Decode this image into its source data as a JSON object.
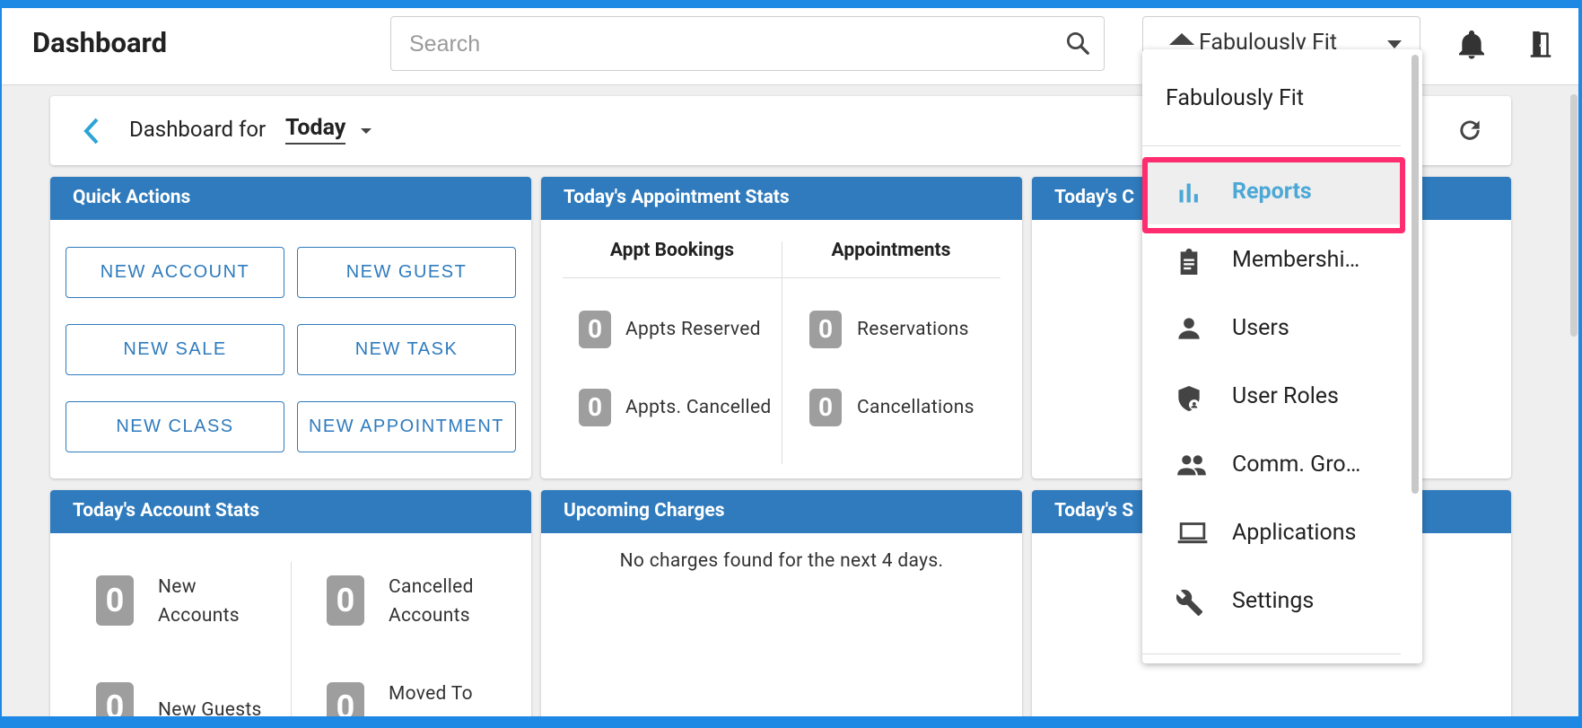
{
  "header": {
    "title": "Dashboard",
    "search_placeholder": "Search",
    "club_name": "Fabulously Fit"
  },
  "dashboard_bar": {
    "label": "Dashboard for",
    "period": "Today"
  },
  "quick_actions": {
    "title": "Quick Actions",
    "buttons": [
      "NEW ACCOUNT",
      "NEW GUEST",
      "NEW SALE",
      "NEW TASK",
      "NEW CLASS",
      "NEW APPOINTMENT"
    ]
  },
  "appointment_stats": {
    "title": "Today's Appointment Stats",
    "col1_header": "Appt Bookings",
    "col2_header": "Appointments",
    "rows": [
      {
        "left_value": "0",
        "left_label": "Appts Reserved",
        "right_value": "0",
        "right_label": "Reservations"
      },
      {
        "left_value": "0",
        "left_label": "Appts. Cancelled",
        "right_value": "0",
        "right_label": "Cancellations"
      }
    ]
  },
  "card3_title": "Today's C",
  "account_stats": {
    "title": "Today's Account Stats",
    "items": [
      {
        "value": "0",
        "label_line1": "New",
        "label_line2": "Accounts"
      },
      {
        "value": "0",
        "label_line1": "Cancelled",
        "label_line2": "Accounts"
      },
      {
        "value": "0",
        "label_line1": "New Guests",
        "label_line2": ""
      },
      {
        "value": "0",
        "label_line1": "Moved To",
        "label_line2": ""
      }
    ]
  },
  "upcoming_charges": {
    "title": "Upcoming Charges",
    "message": "No charges found for the next 4 days."
  },
  "card6_title": "Today's S",
  "menu": {
    "org": "Fabulously Fit",
    "items": [
      {
        "label": "Reports",
        "icon": "bar-chart-icon"
      },
      {
        "label": "Membershi…",
        "icon": "clipboard-icon"
      },
      {
        "label": "Users",
        "icon": "person-icon"
      },
      {
        "label": "User Roles",
        "icon": "shield-user-icon"
      },
      {
        "label": "Comm. Gro…",
        "icon": "people-icon"
      },
      {
        "label": "Applications",
        "icon": "laptop-icon"
      },
      {
        "label": "Settings",
        "icon": "wrench-icon"
      }
    ],
    "highlight_color": "#ff2d6f"
  },
  "colors": {
    "header_blue": "#2f7bbd",
    "accent": "#4ba8d6",
    "frame": "#1e88e5"
  }
}
